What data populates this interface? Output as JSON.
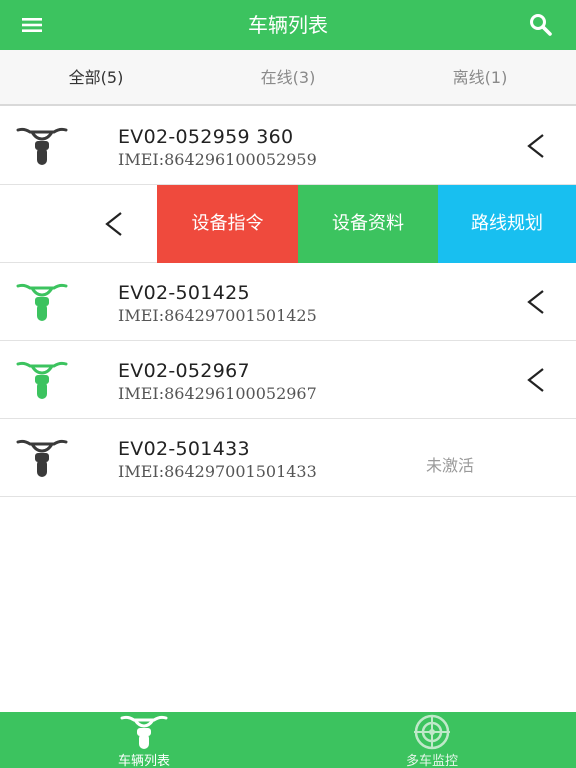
{
  "header": {
    "title": "车辆列表",
    "menu_icon": "menu-icon",
    "search_icon": "search-icon"
  },
  "tabs": [
    {
      "label": "全部(5)",
      "active": true
    },
    {
      "label": "在线(3)",
      "active": false
    },
    {
      "label": "离线(1)",
      "active": false
    }
  ],
  "vehicles": [
    {
      "name": "EV02-052959 360",
      "imei": "IMEI:864296100052959",
      "online": false,
      "status": ""
    },
    {
      "name": "EV02-501425",
      "imei": "IMEI:864297001501425",
      "online": true,
      "status": ""
    },
    {
      "name": "EV02-052967",
      "imei": "IMEI:864296100052967",
      "online": true,
      "status": ""
    },
    {
      "name": "EV02-501433",
      "imei": "IMEI:864297001501433",
      "online": false,
      "status": "未激活"
    }
  ],
  "swipe_actions": {
    "command": "设备指令",
    "info": "设备资料",
    "route": "路线规划"
  },
  "bottom_nav": [
    {
      "label": "车辆列表",
      "icon": "bike-icon",
      "active": true
    },
    {
      "label": "多车监控",
      "icon": "radar-icon",
      "active": false
    }
  ],
  "colors": {
    "primary_green": "#3cc35f",
    "command_red": "#ef4a3d",
    "route_blue": "#18bff0",
    "offline_bike": "#3a3a3a",
    "online_bike": "#3cc35f"
  }
}
